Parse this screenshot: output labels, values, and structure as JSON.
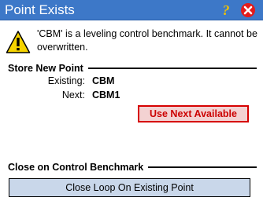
{
  "window": {
    "title": "Point Exists",
    "help_glyph": "?",
    "icons": {
      "help": "help-icon",
      "close": "close-icon",
      "warning": "warning-icon"
    }
  },
  "message": "'CBM' is a leveling control benchmark. It cannot be overwritten.",
  "store_new_point": {
    "heading": "Store New Point",
    "existing_label": "Existing:",
    "existing_value": "CBM",
    "next_label": "Next:",
    "next_value": "CBM1",
    "use_next_button": "Use Next Available"
  },
  "close_on_control": {
    "heading": "Close on Control Benchmark",
    "close_loop_button": "Close Loop On Existing Point"
  },
  "colors": {
    "titlebar": "#3d78c8",
    "accent_red": "#d60000",
    "button_blue": "#c9d7ea"
  }
}
